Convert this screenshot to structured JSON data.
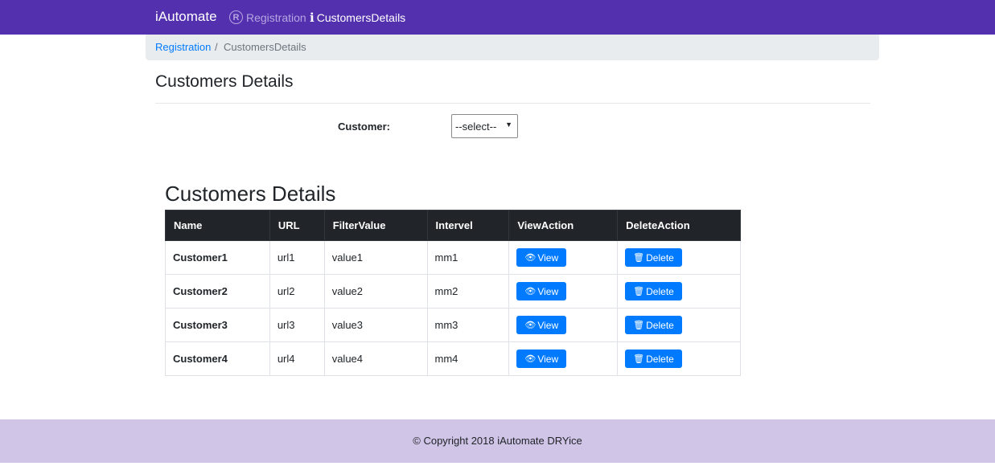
{
  "navbar": {
    "brand": "iAutomate",
    "items": [
      {
        "label": "Registration",
        "icon": "registered-icon"
      },
      {
        "label": "CustomersDetails",
        "icon": "info-icon"
      }
    ]
  },
  "breadcrumb": {
    "link": "Registration",
    "separator": "/",
    "current": "CustomersDetails"
  },
  "page": {
    "title": "Customers Details"
  },
  "filter": {
    "label": "Customer:",
    "selected": "--select--"
  },
  "table": {
    "title": "Customers Details",
    "headers": [
      "Name",
      "URL",
      "FilterValue",
      "Intervel",
      "ViewAction",
      "DeleteAction"
    ],
    "view_label": "View",
    "delete_label": "Delete",
    "rows": [
      {
        "name": "Customer1",
        "url": "url1",
        "filter_value": "value1",
        "intervel": "mm1"
      },
      {
        "name": "Customer2",
        "url": "url2",
        "filter_value": "value2",
        "intervel": "mm2"
      },
      {
        "name": "Customer3",
        "url": "url3",
        "filter_value": "value3",
        "intervel": "mm3"
      },
      {
        "name": "Customer4",
        "url": "url4",
        "filter_value": "value4",
        "intervel": "mm4"
      }
    ]
  },
  "footer": {
    "text": "© Copyright 2018 iAutomate DRYice"
  },
  "colors": {
    "navbar": "#5330ae",
    "button": "#007bff",
    "table_header": "#212529",
    "footer": "#d0c4e7"
  }
}
